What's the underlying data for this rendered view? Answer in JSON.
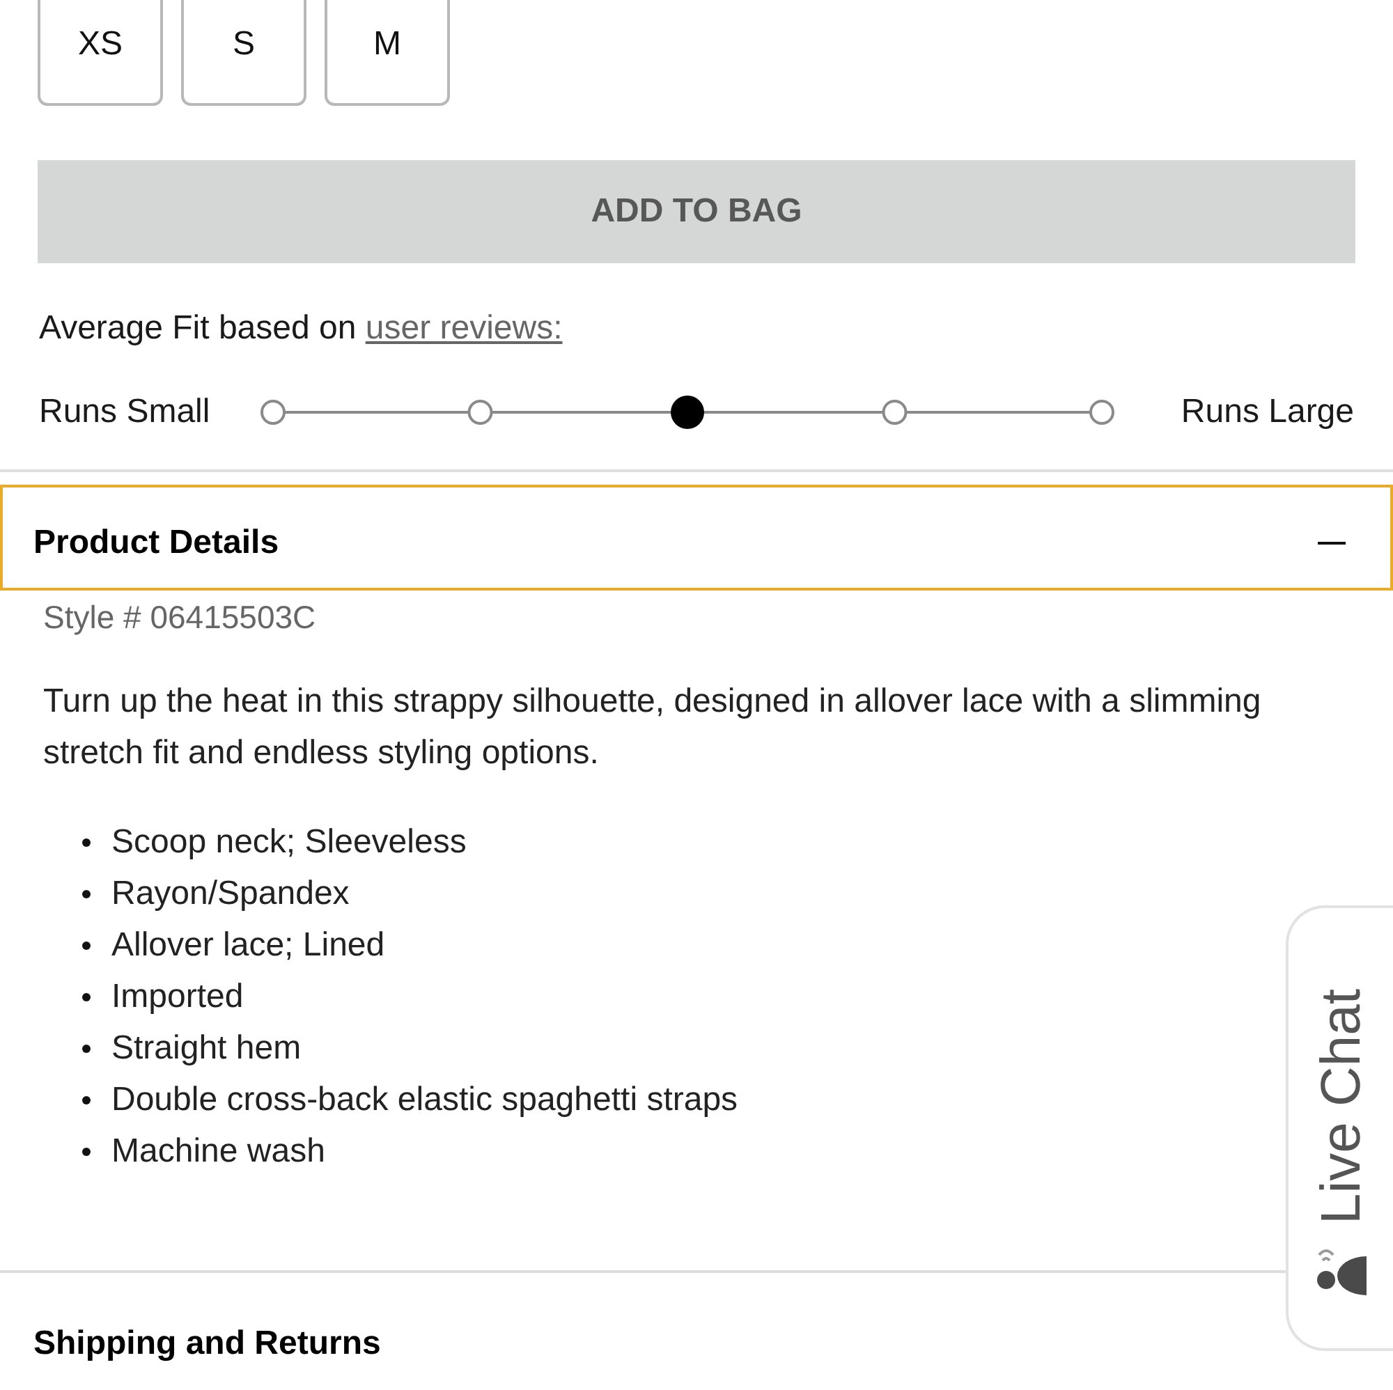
{
  "sizes": [
    {
      "label": "XS",
      "selected": false
    },
    {
      "label": "S",
      "selected": false
    },
    {
      "label": "M",
      "selected": false
    }
  ],
  "add_to_bag": {
    "label": "ADD TO BAG",
    "disabled": true
  },
  "fit": {
    "intro": "Average Fit based on",
    "link": "user reviews:",
    "low_label": "Runs Small",
    "high_label": "Runs Large",
    "points": [
      {
        "selected": false
      },
      {
        "selected": false
      },
      {
        "selected": true
      },
      {
        "selected": false
      },
      {
        "selected": false
      }
    ]
  },
  "accordions": [
    {
      "title": "Product Details",
      "focused": true,
      "expanded": true,
      "style_number": "Style # 06415503C",
      "description": "Turn up the heat in this strappy silhouette, designed in allover lace with a slimming stretch fit and endless styling options.",
      "features": [
        "Scoop neck; Sleeveless",
        "Rayon/Spandex",
        "Allover lace; Lined",
        "Imported",
        "Straight hem",
        "Double cross-back elastic spaghetti straps",
        "Machine wash"
      ]
    },
    {
      "title": "Shipping and Returns",
      "focused": false
    }
  ],
  "live_chat": {
    "label": "Live Chat"
  }
}
